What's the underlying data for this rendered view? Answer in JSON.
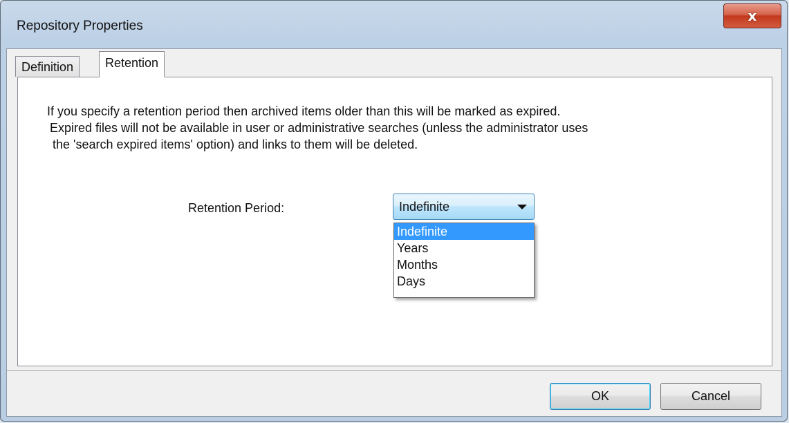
{
  "window": {
    "title": "Repository Properties",
    "close_label": "x"
  },
  "tabs": [
    {
      "label": "Definition"
    },
    {
      "label": "Retention"
    }
  ],
  "description": {
    "line1": "If you specify a retention period then archived items older than this will be marked as expired.",
    "line2": "Expired files will not be available in user or administrative searches (unless the administrator uses",
    "line3": "the 'search expired items' option) and links to them will be deleted."
  },
  "retention": {
    "label": "Retention Period:",
    "selected": "Indefinite",
    "options": [
      "Indefinite",
      "Years",
      "Months",
      "Days"
    ]
  },
  "buttons": {
    "ok_label": "OK",
    "cancel_label": "Cancel"
  },
  "colors": {
    "selection": "#3399ff",
    "close_button": "#c1381c"
  }
}
